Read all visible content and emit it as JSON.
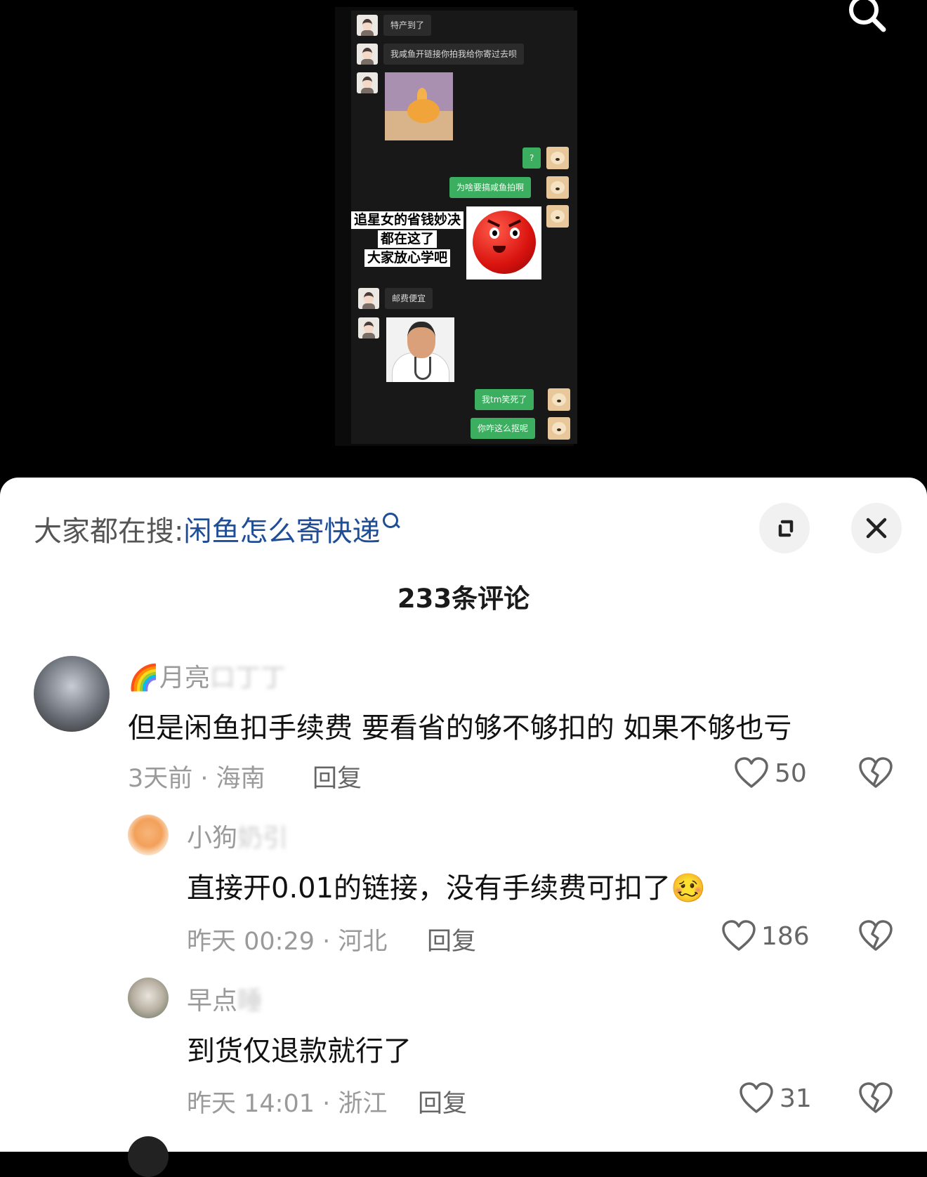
{
  "chat": {
    "messages": [
      {
        "side": "left",
        "type": "text",
        "text": "特产到了"
      },
      {
        "side": "left",
        "type": "text",
        "text": "我咸鱼开链接你拍我给你寄过去呗"
      },
      {
        "side": "left",
        "type": "image",
        "content": "orange-cartoon"
      },
      {
        "side": "right",
        "type": "text",
        "text": "?"
      },
      {
        "side": "right",
        "type": "text",
        "text": "为啥要搞咸鱼拍啊"
      },
      {
        "side": "right",
        "type": "image",
        "content": "angry-red-face"
      },
      {
        "side": "left",
        "type": "text",
        "text": "邮费便宜"
      },
      {
        "side": "left",
        "type": "image",
        "content": "doctor-meme"
      },
      {
        "side": "right",
        "type": "text",
        "text": "我tm笑死了"
      },
      {
        "side": "right",
        "type": "text",
        "text": "你咋这么抠呢"
      }
    ],
    "caption": [
      "追星女的省钱妙决",
      "都在这了",
      "大家放心学吧"
    ]
  },
  "top_search_icon": "search-icon",
  "hot_search": {
    "prefix": "大家都在搜:",
    "query": "闲鱼怎么寄快递"
  },
  "buttons": {
    "expand_icon": "expand-icon",
    "close_icon": "close-icon"
  },
  "comments_count": "233条评论",
  "comments": [
    {
      "name": "🌈月亮",
      "name_tail": "口丁丁",
      "text": "但是闲鱼扣手续费  要看省的够不够扣的  如果不够也亏",
      "meta": "3天前 · 海南",
      "reply": "回复",
      "likes": "50"
    },
    {
      "name": "小狗",
      "name_tail": "奶引",
      "text": "直接开0.01的链接，没有手续费可扣了",
      "emoji": "🥴",
      "meta": "昨天 00:29 · 河北",
      "reply": "回复",
      "likes": "186"
    },
    {
      "name": "早点",
      "name_tail": "睡",
      "text": "到货仅退款就行了",
      "meta": "昨天 14:01 · 浙江",
      "reply": "回复",
      "likes": "31"
    }
  ],
  "colors": {
    "link": "#1f4d96",
    "bubble_green": "#3cae5f",
    "sheet_bg": "#ffffff"
  }
}
